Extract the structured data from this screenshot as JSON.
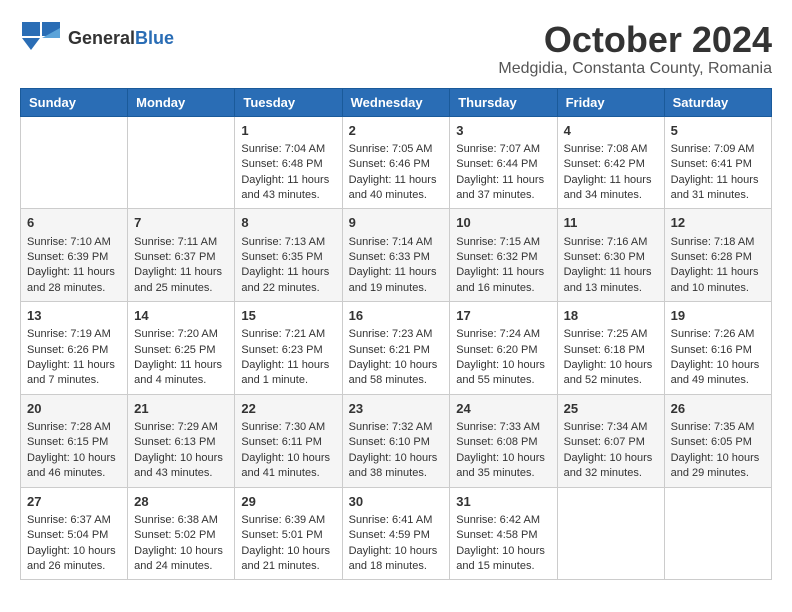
{
  "logo": {
    "general": "General",
    "blue": "Blue"
  },
  "title": "October 2024",
  "location": "Medgidia, Constanta County, Romania",
  "days": [
    "Sunday",
    "Monday",
    "Tuesday",
    "Wednesday",
    "Thursday",
    "Friday",
    "Saturday"
  ],
  "weeks": [
    [
      {
        "num": "",
        "sunrise": "",
        "sunset": "",
        "daylight": ""
      },
      {
        "num": "",
        "sunrise": "",
        "sunset": "",
        "daylight": ""
      },
      {
        "num": "1",
        "sunrise": "Sunrise: 7:04 AM",
        "sunset": "Sunset: 6:48 PM",
        "daylight": "Daylight: 11 hours and 43 minutes."
      },
      {
        "num": "2",
        "sunrise": "Sunrise: 7:05 AM",
        "sunset": "Sunset: 6:46 PM",
        "daylight": "Daylight: 11 hours and 40 minutes."
      },
      {
        "num": "3",
        "sunrise": "Sunrise: 7:07 AM",
        "sunset": "Sunset: 6:44 PM",
        "daylight": "Daylight: 11 hours and 37 minutes."
      },
      {
        "num": "4",
        "sunrise": "Sunrise: 7:08 AM",
        "sunset": "Sunset: 6:42 PM",
        "daylight": "Daylight: 11 hours and 34 minutes."
      },
      {
        "num": "5",
        "sunrise": "Sunrise: 7:09 AM",
        "sunset": "Sunset: 6:41 PM",
        "daylight": "Daylight: 11 hours and 31 minutes."
      }
    ],
    [
      {
        "num": "6",
        "sunrise": "Sunrise: 7:10 AM",
        "sunset": "Sunset: 6:39 PM",
        "daylight": "Daylight: 11 hours and 28 minutes."
      },
      {
        "num": "7",
        "sunrise": "Sunrise: 7:11 AM",
        "sunset": "Sunset: 6:37 PM",
        "daylight": "Daylight: 11 hours and 25 minutes."
      },
      {
        "num": "8",
        "sunrise": "Sunrise: 7:13 AM",
        "sunset": "Sunset: 6:35 PM",
        "daylight": "Daylight: 11 hours and 22 minutes."
      },
      {
        "num": "9",
        "sunrise": "Sunrise: 7:14 AM",
        "sunset": "Sunset: 6:33 PM",
        "daylight": "Daylight: 11 hours and 19 minutes."
      },
      {
        "num": "10",
        "sunrise": "Sunrise: 7:15 AM",
        "sunset": "Sunset: 6:32 PM",
        "daylight": "Daylight: 11 hours and 16 minutes."
      },
      {
        "num": "11",
        "sunrise": "Sunrise: 7:16 AM",
        "sunset": "Sunset: 6:30 PM",
        "daylight": "Daylight: 11 hours and 13 minutes."
      },
      {
        "num": "12",
        "sunrise": "Sunrise: 7:18 AM",
        "sunset": "Sunset: 6:28 PM",
        "daylight": "Daylight: 11 hours and 10 minutes."
      }
    ],
    [
      {
        "num": "13",
        "sunrise": "Sunrise: 7:19 AM",
        "sunset": "Sunset: 6:26 PM",
        "daylight": "Daylight: 11 hours and 7 minutes."
      },
      {
        "num": "14",
        "sunrise": "Sunrise: 7:20 AM",
        "sunset": "Sunset: 6:25 PM",
        "daylight": "Daylight: 11 hours and 4 minutes."
      },
      {
        "num": "15",
        "sunrise": "Sunrise: 7:21 AM",
        "sunset": "Sunset: 6:23 PM",
        "daylight": "Daylight: 11 hours and 1 minute."
      },
      {
        "num": "16",
        "sunrise": "Sunrise: 7:23 AM",
        "sunset": "Sunset: 6:21 PM",
        "daylight": "Daylight: 10 hours and 58 minutes."
      },
      {
        "num": "17",
        "sunrise": "Sunrise: 7:24 AM",
        "sunset": "Sunset: 6:20 PM",
        "daylight": "Daylight: 10 hours and 55 minutes."
      },
      {
        "num": "18",
        "sunrise": "Sunrise: 7:25 AM",
        "sunset": "Sunset: 6:18 PM",
        "daylight": "Daylight: 10 hours and 52 minutes."
      },
      {
        "num": "19",
        "sunrise": "Sunrise: 7:26 AM",
        "sunset": "Sunset: 6:16 PM",
        "daylight": "Daylight: 10 hours and 49 minutes."
      }
    ],
    [
      {
        "num": "20",
        "sunrise": "Sunrise: 7:28 AM",
        "sunset": "Sunset: 6:15 PM",
        "daylight": "Daylight: 10 hours and 46 minutes."
      },
      {
        "num": "21",
        "sunrise": "Sunrise: 7:29 AM",
        "sunset": "Sunset: 6:13 PM",
        "daylight": "Daylight: 10 hours and 43 minutes."
      },
      {
        "num": "22",
        "sunrise": "Sunrise: 7:30 AM",
        "sunset": "Sunset: 6:11 PM",
        "daylight": "Daylight: 10 hours and 41 minutes."
      },
      {
        "num": "23",
        "sunrise": "Sunrise: 7:32 AM",
        "sunset": "Sunset: 6:10 PM",
        "daylight": "Daylight: 10 hours and 38 minutes."
      },
      {
        "num": "24",
        "sunrise": "Sunrise: 7:33 AM",
        "sunset": "Sunset: 6:08 PM",
        "daylight": "Daylight: 10 hours and 35 minutes."
      },
      {
        "num": "25",
        "sunrise": "Sunrise: 7:34 AM",
        "sunset": "Sunset: 6:07 PM",
        "daylight": "Daylight: 10 hours and 32 minutes."
      },
      {
        "num": "26",
        "sunrise": "Sunrise: 7:35 AM",
        "sunset": "Sunset: 6:05 PM",
        "daylight": "Daylight: 10 hours and 29 minutes."
      }
    ],
    [
      {
        "num": "27",
        "sunrise": "Sunrise: 6:37 AM",
        "sunset": "Sunset: 5:04 PM",
        "daylight": "Daylight: 10 hours and 26 minutes."
      },
      {
        "num": "28",
        "sunrise": "Sunrise: 6:38 AM",
        "sunset": "Sunset: 5:02 PM",
        "daylight": "Daylight: 10 hours and 24 minutes."
      },
      {
        "num": "29",
        "sunrise": "Sunrise: 6:39 AM",
        "sunset": "Sunset: 5:01 PM",
        "daylight": "Daylight: 10 hours and 21 minutes."
      },
      {
        "num": "30",
        "sunrise": "Sunrise: 6:41 AM",
        "sunset": "Sunset: 4:59 PM",
        "daylight": "Daylight: 10 hours and 18 minutes."
      },
      {
        "num": "31",
        "sunrise": "Sunrise: 6:42 AM",
        "sunset": "Sunset: 4:58 PM",
        "daylight": "Daylight: 10 hours and 15 minutes."
      },
      {
        "num": "",
        "sunrise": "",
        "sunset": "",
        "daylight": ""
      },
      {
        "num": "",
        "sunrise": "",
        "sunset": "",
        "daylight": ""
      }
    ]
  ]
}
